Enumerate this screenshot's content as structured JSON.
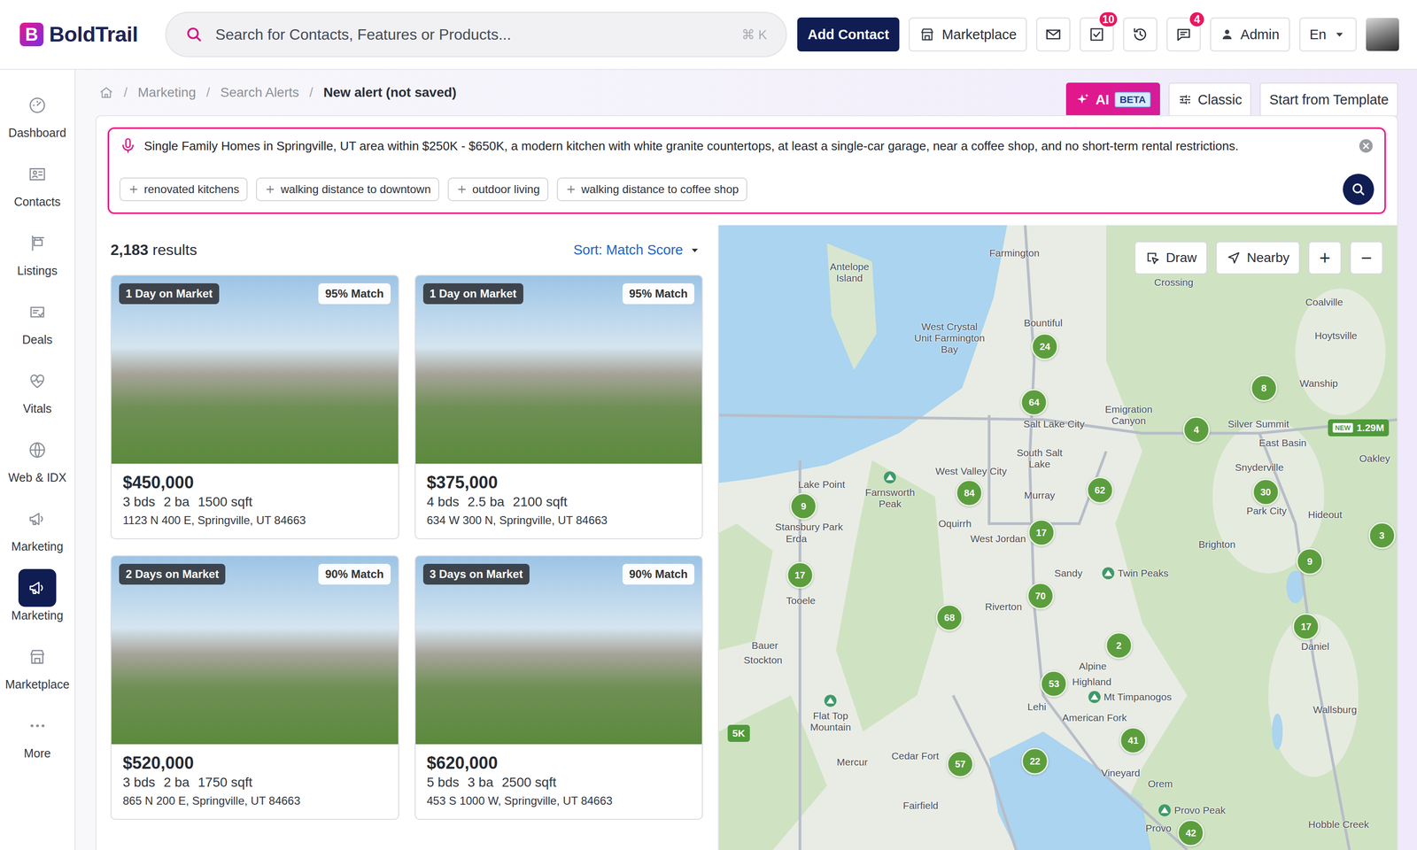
{
  "logo": {
    "mark": "B",
    "name": "BoldTrail"
  },
  "search": {
    "placeholder": "Search for Contacts, Features or Products...",
    "shortcut": "⌘ K"
  },
  "header_actions": {
    "add_contact": "Add Contact",
    "marketplace": "Marketplace",
    "tasks_badge": "10",
    "chat_badge": "4",
    "user": "Admin",
    "language": "En"
  },
  "sidebar": {
    "items": [
      {
        "label": "Dashboard",
        "selected": false
      },
      {
        "label": "Contacts",
        "selected": false
      },
      {
        "label": "Listings",
        "selected": false
      },
      {
        "label": "Deals",
        "selected": false
      },
      {
        "label": "Vitals",
        "selected": false
      },
      {
        "label": "Web & IDX",
        "selected": false
      },
      {
        "label": "Marketing",
        "selected": false
      },
      {
        "label": "Marketing",
        "selected": true
      },
      {
        "label": "Marketplace",
        "selected": false
      },
      {
        "label": "More",
        "selected": false
      }
    ]
  },
  "breadcrumb": {
    "separator": "/",
    "items": [
      "Marketing",
      "Search Alerts",
      "New alert (not saved)"
    ]
  },
  "modes": [
    {
      "label": "AI",
      "badge": "BETA",
      "selected": true
    },
    {
      "label": "Classic",
      "selected": false
    },
    {
      "label": "Start from Template",
      "selected": false
    }
  ],
  "query": {
    "text": "Single Family Homes in Springville, UT area within $250K - $650K, a modern kitchen with white granite countertops, at least a single-car garage, near a coffee shop, and no short-term rental restrictions.",
    "suggestions": [
      "renovated kitchens",
      "walking distance to downtown",
      "outdoor living",
      "walking distance to coffee shop"
    ]
  },
  "results": {
    "count": "2,183",
    "label": "results",
    "sort": "Sort: Match Score"
  },
  "listings": [
    {
      "days": "1 Day on Market",
      "match": "95% Match",
      "price": "$450,000",
      "beds": "3 bds",
      "baths": "2 ba",
      "sqft": "1500 sqft",
      "address": "1123 N 400 E, Springville, UT 84663"
    },
    {
      "days": "1 Day on Market",
      "match": "95% Match",
      "price": "$375,000",
      "beds": "4 bds",
      "baths": "2.5 ba",
      "sqft": "2100 sqft",
      "address": "634 W 300 N, Springville, UT 84663"
    },
    {
      "days": "2 Days on Market",
      "match": "90% Match",
      "price": "$520,000",
      "beds": "3 bds",
      "baths": "2 ba",
      "sqft": "1750 sqft",
      "address": "865 N 200 E, Springville, UT 84663"
    },
    {
      "days": "3 Days on Market",
      "match": "90% Match",
      "price": "$620,000",
      "beds": "5 bds",
      "baths": "3 ba",
      "sqft": "2500 sqft",
      "address": "453 S 1000 W, Springville, UT 84663"
    }
  ],
  "map": {
    "tools": [
      "Draw",
      "Nearby"
    ],
    "zoom_in": "+",
    "zoom_out": "−",
    "clusters": [
      "24",
      "64",
      "8",
      "4",
      "62",
      "84",
      "30",
      "9",
      "17",
      "17",
      "9",
      "3",
      "70",
      "68",
      "2",
      "17",
      "53",
      "41",
      "57",
      "22",
      "42"
    ],
    "price_tags": [
      {
        "badge": "NEW",
        "label": "1.29M"
      },
      {
        "label": "5K"
      }
    ],
    "labels": [
      "Farmington",
      "Antelope Island",
      "Crossing",
      "Coalville",
      "Bountiful",
      "Hoytsville",
      "West Crystal Unit Farmington Bay",
      "Wanship",
      "Salt Lake City",
      "Emigration Canyon",
      "Silver Summit",
      "East Basin",
      "Oakley",
      "South Salt Lake",
      "Snyderville",
      "West Valley City",
      "Lake Point",
      "Farnsworth Peak",
      "Murray",
      "Park City",
      "Hideout",
      "Stansbury Park",
      "Oquirrh",
      "Erda",
      "West Jordan",
      "Brighton",
      "Sandy",
      "Twin Peaks",
      "Tooele",
      "Riverton",
      "Bauer",
      "Daniel",
      "Stockton",
      "Alpine",
      "Highland",
      "Mt Timpanogos",
      "Lehi",
      "Wallsburg",
      "Flat Top Mountain",
      "American Fork",
      "Cedar Fort",
      "Mercur",
      "Vineyard",
      "Orem",
      "Fairfield",
      "Provo Peak",
      "Provo",
      "Hobble Creek"
    ]
  }
}
